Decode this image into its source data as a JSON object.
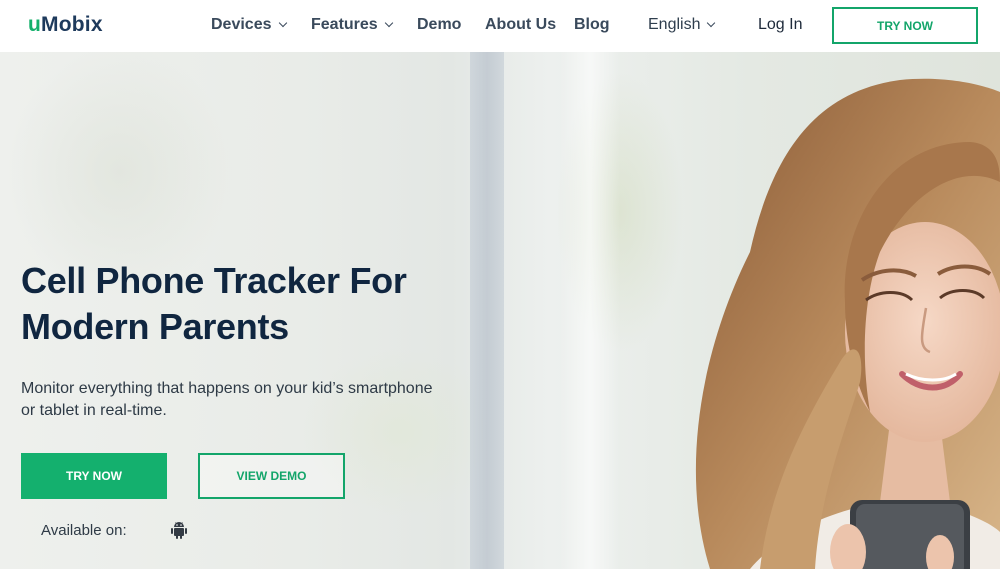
{
  "brand": {
    "logo_u": "u",
    "logo_rest": "Mobix"
  },
  "nav": {
    "devices": "Devices",
    "features": "Features",
    "demo": "Demo",
    "about": "About Us",
    "blog": "Blog",
    "language": "English",
    "login": "Log In",
    "try_now": "TRY NOW"
  },
  "hero": {
    "title_line1": "Cell Phone Tracker For",
    "title_line2": "Modern Parents",
    "subtitle_line1": "Monitor everything that happens on your kid’s smartphone",
    "subtitle_line2": "or tablet in real-time.",
    "try_now": "TRY NOW",
    "view_demo": "VIEW DEMO",
    "available_on": "Available on:",
    "platform_icon": "android-icon"
  },
  "colors": {
    "accent": "#14b06e",
    "heading": "#102640",
    "text": "#2e3a46"
  }
}
